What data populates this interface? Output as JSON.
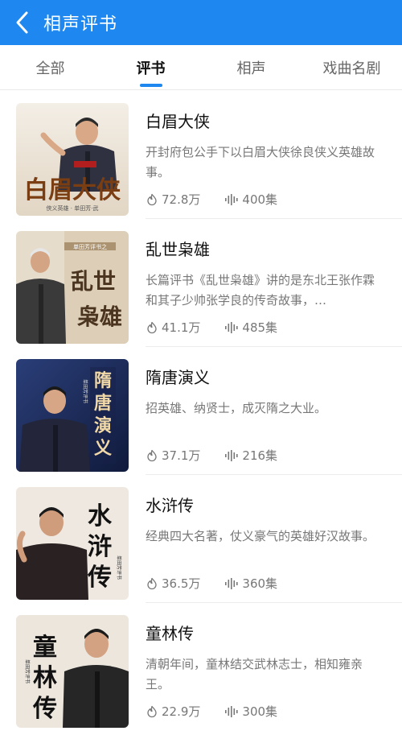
{
  "header": {
    "title": "相声评书",
    "back_icon": "chevron-left-icon"
  },
  "tabs": [
    {
      "label": "全部",
      "active": false
    },
    {
      "label": "评书",
      "active": true
    },
    {
      "label": "相声",
      "active": false
    },
    {
      "label": "戏曲名剧",
      "active": false
    }
  ],
  "colors": {
    "accent": "#1e88f0"
  },
  "items": [
    {
      "title": "白眉大侠",
      "desc": "开封府包公手下以白眉大侠徐良侠义英雄故事。",
      "plays": "72.8万",
      "episodes": "400集",
      "cover": {
        "text": "白眉大侠",
        "small": "单田芳评书",
        "bottom": "侠义英雄 · 单田芳·武"
      }
    },
    {
      "title": "乱世枭雄",
      "desc": "长篇评书《乱世枭雄》讲的是东北王张作霖和其子少帅张学良的传奇故事，…",
      "plays": "41.1万",
      "episodes": "485集",
      "cover": {
        "text": "乱世枭雄",
        "small": "单田芳评书之",
        "bottom": ""
      }
    },
    {
      "title": "隋唐演义",
      "desc": "招英雄、纳贤士，成灭隋之大业。",
      "plays": "37.1万",
      "episodes": "216集",
      "cover": {
        "text": "隋唐演义",
        "small": "单田芳评书",
        "bottom": ""
      }
    },
    {
      "title": "水浒传",
      "desc": "经典四大名著，仗义豪气的英雄好汉故事。",
      "plays": "36.5万",
      "episodes": "360集",
      "cover": {
        "text": "水浒传",
        "small": "单田芳评书",
        "bottom": ""
      }
    },
    {
      "title": "童林传",
      "desc": "清朝年间，童林结交武林志士，相知雍亲王。",
      "plays": "22.9万",
      "episodes": "300集",
      "cover": {
        "text": "童林传",
        "small": "单田芳评书",
        "bottom": ""
      }
    }
  ]
}
